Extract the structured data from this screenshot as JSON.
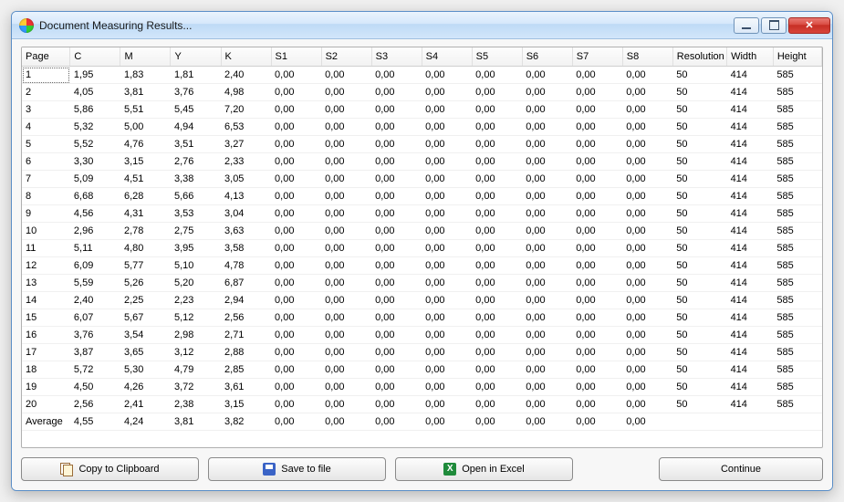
{
  "window": {
    "title": "Document Measuring Results..."
  },
  "columns": [
    "Page",
    "C",
    "M",
    "Y",
    "K",
    "S1",
    "S2",
    "S3",
    "S4",
    "S5",
    "S6",
    "S7",
    "S8",
    "Resolution",
    "Width",
    "Height"
  ],
  "rows": [
    {
      "page": "1",
      "c": "1,95",
      "m": "1,83",
      "y": "1,81",
      "k": "2,40",
      "s1": "0,00",
      "s2": "0,00",
      "s3": "0,00",
      "s4": "0,00",
      "s5": "0,00",
      "s6": "0,00",
      "s7": "0,00",
      "s8": "0,00",
      "res": "50",
      "w": "414",
      "h": "585"
    },
    {
      "page": "2",
      "c": "4,05",
      "m": "3,81",
      "y": "3,76",
      "k": "4,98",
      "s1": "0,00",
      "s2": "0,00",
      "s3": "0,00",
      "s4": "0,00",
      "s5": "0,00",
      "s6": "0,00",
      "s7": "0,00",
      "s8": "0,00",
      "res": "50",
      "w": "414",
      "h": "585"
    },
    {
      "page": "3",
      "c": "5,86",
      "m": "5,51",
      "y": "5,45",
      "k": "7,20",
      "s1": "0,00",
      "s2": "0,00",
      "s3": "0,00",
      "s4": "0,00",
      "s5": "0,00",
      "s6": "0,00",
      "s7": "0,00",
      "s8": "0,00",
      "res": "50",
      "w": "414",
      "h": "585"
    },
    {
      "page": "4",
      "c": "5,32",
      "m": "5,00",
      "y": "4,94",
      "k": "6,53",
      "s1": "0,00",
      "s2": "0,00",
      "s3": "0,00",
      "s4": "0,00",
      "s5": "0,00",
      "s6": "0,00",
      "s7": "0,00",
      "s8": "0,00",
      "res": "50",
      "w": "414",
      "h": "585"
    },
    {
      "page": "5",
      "c": "5,52",
      "m": "4,76",
      "y": "3,51",
      "k": "3,27",
      "s1": "0,00",
      "s2": "0,00",
      "s3": "0,00",
      "s4": "0,00",
      "s5": "0,00",
      "s6": "0,00",
      "s7": "0,00",
      "s8": "0,00",
      "res": "50",
      "w": "414",
      "h": "585"
    },
    {
      "page": "6",
      "c": "3,30",
      "m": "3,15",
      "y": "2,76",
      "k": "2,33",
      "s1": "0,00",
      "s2": "0,00",
      "s3": "0,00",
      "s4": "0,00",
      "s5": "0,00",
      "s6": "0,00",
      "s7": "0,00",
      "s8": "0,00",
      "res": "50",
      "w": "414",
      "h": "585"
    },
    {
      "page": "7",
      "c": "5,09",
      "m": "4,51",
      "y": "3,38",
      "k": "3,05",
      "s1": "0,00",
      "s2": "0,00",
      "s3": "0,00",
      "s4": "0,00",
      "s5": "0,00",
      "s6": "0,00",
      "s7": "0,00",
      "s8": "0,00",
      "res": "50",
      "w": "414",
      "h": "585"
    },
    {
      "page": "8",
      "c": "6,68",
      "m": "6,28",
      "y": "5,66",
      "k": "4,13",
      "s1": "0,00",
      "s2": "0,00",
      "s3": "0,00",
      "s4": "0,00",
      "s5": "0,00",
      "s6": "0,00",
      "s7": "0,00",
      "s8": "0,00",
      "res": "50",
      "w": "414",
      "h": "585"
    },
    {
      "page": "9",
      "c": "4,56",
      "m": "4,31",
      "y": "3,53",
      "k": "3,04",
      "s1": "0,00",
      "s2": "0,00",
      "s3": "0,00",
      "s4": "0,00",
      "s5": "0,00",
      "s6": "0,00",
      "s7": "0,00",
      "s8": "0,00",
      "res": "50",
      "w": "414",
      "h": "585"
    },
    {
      "page": "10",
      "c": "2,96",
      "m": "2,78",
      "y": "2,75",
      "k": "3,63",
      "s1": "0,00",
      "s2": "0,00",
      "s3": "0,00",
      "s4": "0,00",
      "s5": "0,00",
      "s6": "0,00",
      "s7": "0,00",
      "s8": "0,00",
      "res": "50",
      "w": "414",
      "h": "585"
    },
    {
      "page": "11",
      "c": "5,11",
      "m": "4,80",
      "y": "3,95",
      "k": "3,58",
      "s1": "0,00",
      "s2": "0,00",
      "s3": "0,00",
      "s4": "0,00",
      "s5": "0,00",
      "s6": "0,00",
      "s7": "0,00",
      "s8": "0,00",
      "res": "50",
      "w": "414",
      "h": "585"
    },
    {
      "page": "12",
      "c": "6,09",
      "m": "5,77",
      "y": "5,10",
      "k": "4,78",
      "s1": "0,00",
      "s2": "0,00",
      "s3": "0,00",
      "s4": "0,00",
      "s5": "0,00",
      "s6": "0,00",
      "s7": "0,00",
      "s8": "0,00",
      "res": "50",
      "w": "414",
      "h": "585"
    },
    {
      "page": "13",
      "c": "5,59",
      "m": "5,26",
      "y": "5,20",
      "k": "6,87",
      "s1": "0,00",
      "s2": "0,00",
      "s3": "0,00",
      "s4": "0,00",
      "s5": "0,00",
      "s6": "0,00",
      "s7": "0,00",
      "s8": "0,00",
      "res": "50",
      "w": "414",
      "h": "585"
    },
    {
      "page": "14",
      "c": "2,40",
      "m": "2,25",
      "y": "2,23",
      "k": "2,94",
      "s1": "0,00",
      "s2": "0,00",
      "s3": "0,00",
      "s4": "0,00",
      "s5": "0,00",
      "s6": "0,00",
      "s7": "0,00",
      "s8": "0,00",
      "res": "50",
      "w": "414",
      "h": "585"
    },
    {
      "page": "15",
      "c": "6,07",
      "m": "5,67",
      "y": "5,12",
      "k": "2,56",
      "s1": "0,00",
      "s2": "0,00",
      "s3": "0,00",
      "s4": "0,00",
      "s5": "0,00",
      "s6": "0,00",
      "s7": "0,00",
      "s8": "0,00",
      "res": "50",
      "w": "414",
      "h": "585"
    },
    {
      "page": "16",
      "c": "3,76",
      "m": "3,54",
      "y": "2,98",
      "k": "2,71",
      "s1": "0,00",
      "s2": "0,00",
      "s3": "0,00",
      "s4": "0,00",
      "s5": "0,00",
      "s6": "0,00",
      "s7": "0,00",
      "s8": "0,00",
      "res": "50",
      "w": "414",
      "h": "585"
    },
    {
      "page": "17",
      "c": "3,87",
      "m": "3,65",
      "y": "3,12",
      "k": "2,88",
      "s1": "0,00",
      "s2": "0,00",
      "s3": "0,00",
      "s4": "0,00",
      "s5": "0,00",
      "s6": "0,00",
      "s7": "0,00",
      "s8": "0,00",
      "res": "50",
      "w": "414",
      "h": "585"
    },
    {
      "page": "18",
      "c": "5,72",
      "m": "5,30",
      "y": "4,79",
      "k": "2,85",
      "s1": "0,00",
      "s2": "0,00",
      "s3": "0,00",
      "s4": "0,00",
      "s5": "0,00",
      "s6": "0,00",
      "s7": "0,00",
      "s8": "0,00",
      "res": "50",
      "w": "414",
      "h": "585"
    },
    {
      "page": "19",
      "c": "4,50",
      "m": "4,26",
      "y": "3,72",
      "k": "3,61",
      "s1": "0,00",
      "s2": "0,00",
      "s3": "0,00",
      "s4": "0,00",
      "s5": "0,00",
      "s6": "0,00",
      "s7": "0,00",
      "s8": "0,00",
      "res": "50",
      "w": "414",
      "h": "585"
    },
    {
      "page": "20",
      "c": "2,56",
      "m": "2,41",
      "y": "2,38",
      "k": "3,15",
      "s1": "0,00",
      "s2": "0,00",
      "s3": "0,00",
      "s4": "0,00",
      "s5": "0,00",
      "s6": "0,00",
      "s7": "0,00",
      "s8": "0,00",
      "res": "50",
      "w": "414",
      "h": "585"
    },
    {
      "page": "Average",
      "c": "4,55",
      "m": "4,24",
      "y": "3,81",
      "k": "3,82",
      "s1": "0,00",
      "s2": "0,00",
      "s3": "0,00",
      "s4": "0,00",
      "s5": "0,00",
      "s6": "0,00",
      "s7": "0,00",
      "s8": "0,00",
      "res": "",
      "w": "",
      "h": ""
    }
  ],
  "buttons": {
    "copy": "Copy to Clipboard",
    "save": "Save to file",
    "excel": "Open in Excel",
    "continue": "Continue"
  }
}
